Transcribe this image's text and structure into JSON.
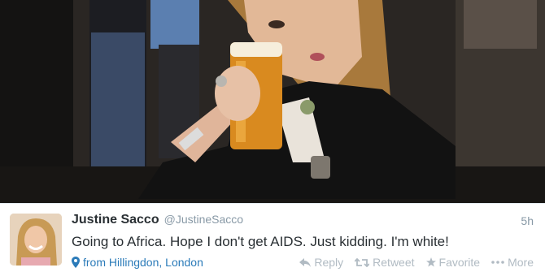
{
  "tweet": {
    "display_name": "Justine Sacco",
    "handle": "@JustineSacco",
    "time": "5h",
    "text": "Going to Africa. Hope I don't get AIDS. Just kidding. I'm white!",
    "location": "from Hillingdon, London",
    "location_icon": "map-pin-icon",
    "actions": {
      "reply": "Reply",
      "retweet": "Retweet",
      "favorite": "Favorite",
      "more": "More"
    }
  },
  "colors": {
    "name": "#292f33",
    "meta": "#8899a6",
    "link": "#2b7bb9",
    "action": "#b1bbc3"
  }
}
